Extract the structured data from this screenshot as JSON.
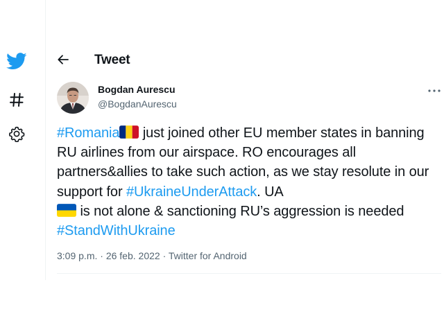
{
  "header": {
    "title": "Tweet"
  },
  "nav": {
    "icons": [
      "twitter-bird-icon",
      "hashtag-icon",
      "gear-icon"
    ]
  },
  "tweet": {
    "author_name": "Bogdan Aurescu",
    "author_handle": "@BogdanAurescu",
    "text": {
      "hashtag_romania": "#Romania",
      "flag_romania": "Romania flag",
      "part_1": " just joined other EU member states in banning RU airlines from our airspace. RO encourages all partners&allies to take such action, as we stay resolute in our support for ",
      "hashtag_ukraine_attack": "#UkraineUnderAttack",
      "part_2": ". UA ",
      "flag_ukraine": "Ukraine flag",
      "part_3": " is not alone & sanctioning RU’s aggression is needed ",
      "hashtag_stand": "#StandWithUkraine"
    },
    "time": "3:09 p.m.",
    "separator": "·",
    "date": "26 feb. 2022",
    "source": "Twitter for Android"
  },
  "colors": {
    "twitter_blue": "#1d9bf0",
    "text_primary": "#0f1419",
    "text_secondary": "#536471",
    "divider": "#eff3f4",
    "romania_flag": [
      "#002b7f",
      "#fcd116",
      "#ce1126"
    ],
    "ukraine_flag": [
      "#0057b7",
      "#ffd700"
    ]
  }
}
